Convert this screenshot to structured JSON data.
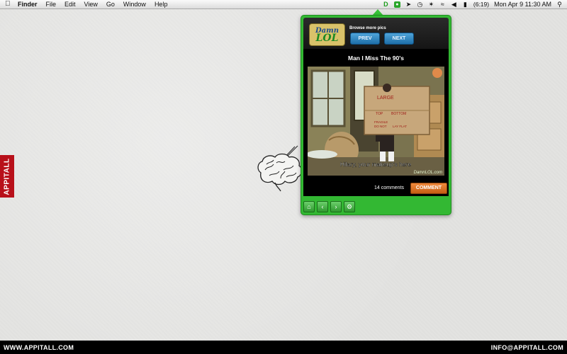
{
  "menubar": {
    "items": [
      "Finder",
      "File",
      "Edit",
      "View",
      "Go",
      "Window",
      "Help"
    ],
    "status_icons": [
      "damnlol-icon",
      "evernote-icon",
      "cursor-icon",
      "timemachine-icon",
      "bluetooth-icon",
      "wifi-icon",
      "volume-icon",
      "battery-icon"
    ],
    "battery": "(6:19)",
    "clock": "Mon Apr 9  11:30 AM"
  },
  "side_tab": {
    "label": "APPITALL"
  },
  "footer": {
    "left": "WWW.APPITALL.COM",
    "right": "INFO@APPITALL.COM"
  },
  "widget": {
    "logo": {
      "line1": "Damn",
      "line2": "LOL"
    },
    "browse_label": "Browse more pics",
    "prev_label": "PREV",
    "next_label": "NEXT",
    "title": "Man I Miss The 90's",
    "image": {
      "box_large": "LARGE",
      "box_top": "TOP",
      "box_bottom": "BOTTOM",
      "box_fragile": "FRAGILE",
      "box_do_not": "DO NOT",
      "box_lay_flat": "LAY FLAT",
      "subtitle": "Hilary, your makeup's here",
      "watermark": "DamnLOL.com"
    },
    "comments_text": "14 comments",
    "comment_button": "COMMENT",
    "toolbar": [
      "home-icon",
      "back-icon",
      "forward-icon",
      "settings-icon"
    ]
  },
  "colors": {
    "accent_green": "#33b833",
    "appitall_red": "#b8101a",
    "button_blue": "#2c82c2",
    "comment_orange": "#e07a2a"
  }
}
